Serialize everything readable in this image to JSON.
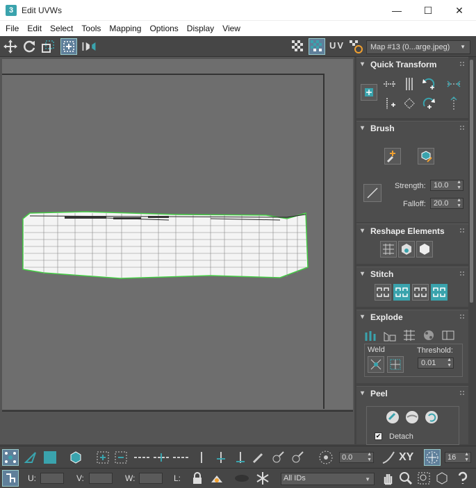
{
  "window": {
    "title": "Edit UVWs",
    "app_glyph": "3",
    "minimize": "—",
    "maximize": "☐",
    "close": "✕"
  },
  "menu": [
    "File",
    "Edit",
    "Select",
    "Tools",
    "Mapping",
    "Options",
    "Display",
    "View"
  ],
  "toolbar": {
    "uv_label": "UV",
    "map_select": "Map #13 (0...arge.jpeg)"
  },
  "panel": {
    "quick_transform": {
      "title": "Quick Transform"
    },
    "brush": {
      "title": "Brush",
      "strength_label": "Strength:",
      "strength": "10.0",
      "falloff_label": "Falloff:",
      "falloff": "20.0"
    },
    "reshape": {
      "title": "Reshape Elements"
    },
    "stitch": {
      "title": "Stitch"
    },
    "explode": {
      "title": "Explode",
      "weld_label": "Weld",
      "threshold_label": "Threshold:",
      "threshold": "0.01"
    },
    "peel": {
      "title": "Peel",
      "detach_label": "Detach",
      "detach_check": "✔"
    }
  },
  "bottom": {
    "rotate_value": "0.0",
    "xy_label": "XY",
    "grid_value": "16",
    "u_label": "U:",
    "v_label": "V:",
    "w_label": "W:",
    "l_label": "L:",
    "ids_select": "All IDs"
  },
  "colors": {
    "accent": "#3aa3ad",
    "uv_shell": "#ffffff",
    "selection_edge": "#44cc44",
    "background": "#444444"
  }
}
